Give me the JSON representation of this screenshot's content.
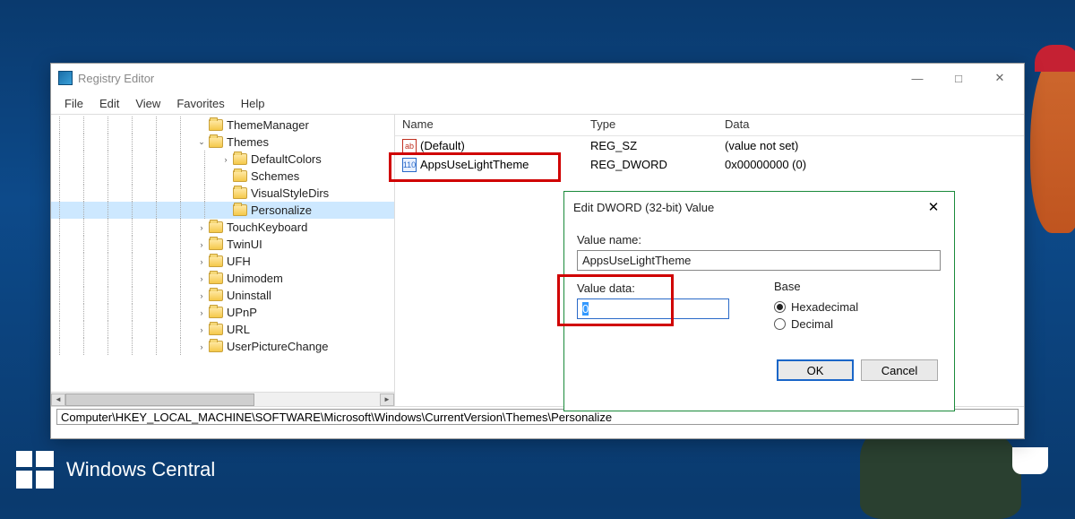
{
  "window": {
    "title": "Registry Editor",
    "menus": [
      "File",
      "Edit",
      "View",
      "Favorites",
      "Help"
    ],
    "controls": {
      "min": "—",
      "max": "□",
      "close": "✕"
    }
  },
  "tree": {
    "nodes": [
      {
        "depth": 6,
        "expander": "",
        "label": "ThemeManager",
        "open": false
      },
      {
        "depth": 6,
        "expander": "⌄",
        "label": "Themes",
        "open": true
      },
      {
        "depth": 7,
        "expander": "›",
        "label": "DefaultColors",
        "open": false
      },
      {
        "depth": 7,
        "expander": "",
        "label": "Schemes",
        "open": false
      },
      {
        "depth": 7,
        "expander": "",
        "label": "VisualStyleDirs",
        "open": false
      },
      {
        "depth": 7,
        "expander": "",
        "label": "Personalize",
        "open": true,
        "selected": true
      },
      {
        "depth": 6,
        "expander": "›",
        "label": "TouchKeyboard",
        "open": false
      },
      {
        "depth": 6,
        "expander": "›",
        "label": "TwinUI",
        "open": false
      },
      {
        "depth": 6,
        "expander": "›",
        "label": "UFH",
        "open": false
      },
      {
        "depth": 6,
        "expander": "›",
        "label": "Unimodem",
        "open": false
      },
      {
        "depth": 6,
        "expander": "›",
        "label": "Uninstall",
        "open": false
      },
      {
        "depth": 6,
        "expander": "›",
        "label": "UPnP",
        "open": false
      },
      {
        "depth": 6,
        "expander": "›",
        "label": "URL",
        "open": false
      },
      {
        "depth": 6,
        "expander": "›",
        "label": "UserPictureChange",
        "open": false
      }
    ]
  },
  "list": {
    "columns": {
      "name": "Name",
      "type": "Type",
      "data": "Data"
    },
    "rows": [
      {
        "icon": "sz",
        "name": "(Default)",
        "type": "REG_SZ",
        "data": "(value not set)"
      },
      {
        "icon": "dw",
        "name": "AppsUseLightTheme",
        "type": "REG_DWORD",
        "data": "0x00000000 (0)",
        "highlight": true
      }
    ]
  },
  "path": "Computer\\HKEY_LOCAL_MACHINE\\SOFTWARE\\Microsoft\\Windows\\CurrentVersion\\Themes\\Personalize",
  "dialog": {
    "title": "Edit DWORD (32-bit) Value",
    "close": "✕",
    "valueNameLabel": "Value name:",
    "valueName": "AppsUseLightTheme",
    "valueDataLabel": "Value data:",
    "valueData": "0",
    "baseLabel": "Base",
    "hex": "Hexadecimal",
    "dec": "Decimal",
    "ok": "OK",
    "cancel": "Cancel"
  },
  "watermark": "Windows Central"
}
